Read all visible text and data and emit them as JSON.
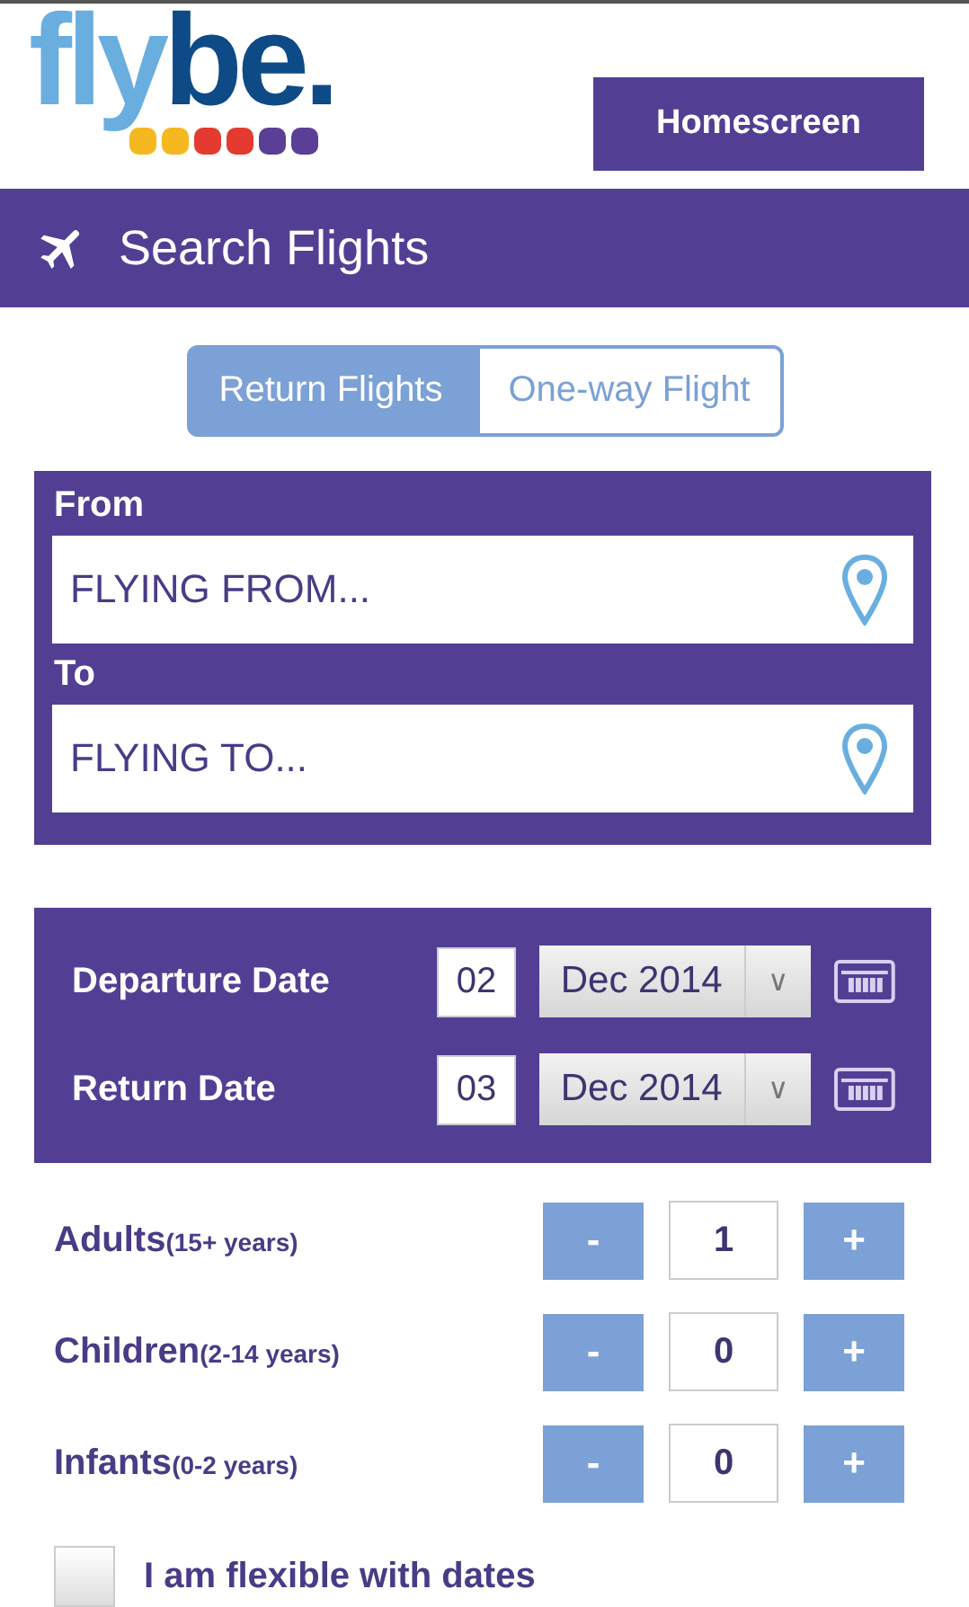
{
  "logo": {
    "light": "fly",
    "dark": "be."
  },
  "home_button": "Homescreen",
  "title": "Search Flights",
  "trip_tabs": [
    {
      "label": "Return Flights",
      "selected": true
    },
    {
      "label": "One-way Flight",
      "selected": false
    }
  ],
  "route": [
    {
      "label": "From",
      "placeholder": "FLYING FROM..."
    },
    {
      "label": "To",
      "placeholder": "FLYING TO..."
    }
  ],
  "dates": [
    {
      "label": "Departure Date",
      "day": "02",
      "month": "Dec 2014",
      "arrow": "∨"
    },
    {
      "label": "Return Date",
      "day": "03",
      "month": "Dec 2014",
      "arrow": "∨"
    }
  ],
  "passengers": [
    {
      "label": "Adults",
      "note": "(15+ years)",
      "minus": "-",
      "count": "1",
      "plus": "+"
    },
    {
      "label": "Children",
      "note": "(2-14 years)",
      "minus": "-",
      "count": "0",
      "plus": "+"
    },
    {
      "label": "Infants",
      "note": "(0-2 years)",
      "minus": "-",
      "count": "0",
      "plus": "+"
    }
  ],
  "flexible": {
    "label": "I am flexible with dates",
    "checked": false
  }
}
